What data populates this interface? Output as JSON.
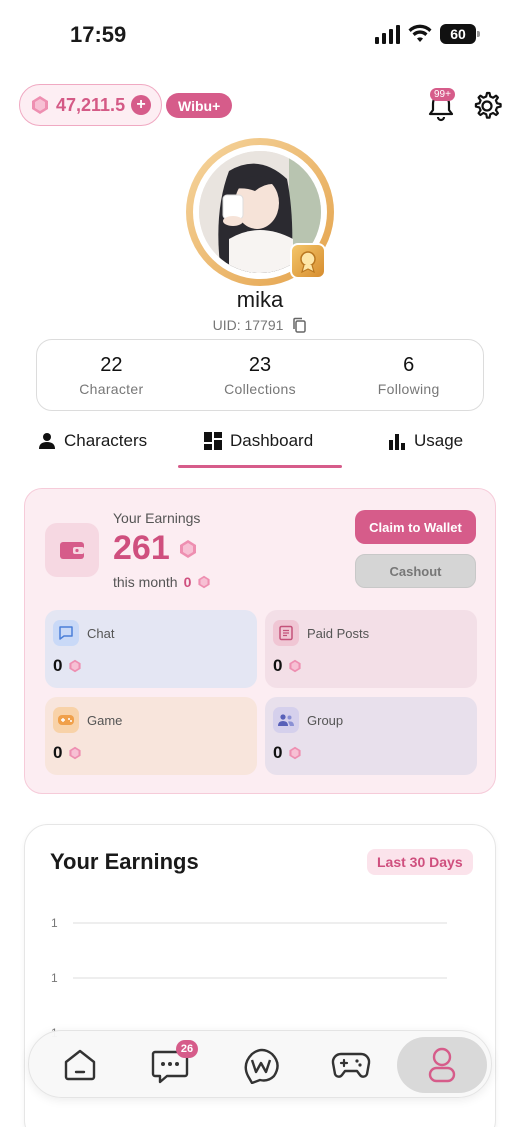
{
  "status_bar": {
    "time": "17:59",
    "battery": "60"
  },
  "header": {
    "gem_balance": "47,211.5",
    "plus_label": "+",
    "membership_badge": "Wibu+",
    "notification_count": "99+"
  },
  "profile": {
    "username": "mika",
    "uid": "UID: 17791"
  },
  "stats": [
    {
      "value": "22",
      "label": "Character"
    },
    {
      "value": "23",
      "label": "Collections"
    },
    {
      "value": "6",
      "label": "Following"
    }
  ],
  "tabs": [
    {
      "label": "Characters",
      "icon": "person-icon"
    },
    {
      "label": "Dashboard",
      "icon": "dashboard-icon",
      "active": true
    },
    {
      "label": "Usage",
      "icon": "bar-chart-icon"
    }
  ],
  "earnings": {
    "title": "Your Earnings",
    "amount": "261",
    "month_label": "this month",
    "month_value": "0",
    "claim_label": "Claim to Wallet",
    "cashout_label": "Cashout",
    "categories": [
      {
        "label": "Chat",
        "value": "0",
        "icon": "chat-icon",
        "color": "#e4e6f3",
        "icon_bg": "#c9d9f7"
      },
      {
        "label": "Paid Posts",
        "value": "0",
        "icon": "document-icon",
        "color": "#f3dfe7",
        "icon_bg": "#f0c6d4"
      },
      {
        "label": "Game",
        "value": "0",
        "icon": "gamepad-icon",
        "color": "#f8e5dc",
        "icon_bg": "#f8d2a8"
      },
      {
        "label": "Group",
        "value": "0",
        "icon": "group-icon",
        "color": "#e8e0ec",
        "icon_bg": "#d5d0ec"
      }
    ]
  },
  "chart": {
    "title": "Your Earnings",
    "range": "Last 30 Days"
  },
  "chart_data": {
    "type": "line",
    "title": "Your Earnings",
    "y_tick_labels": [
      "1",
      "1",
      "1"
    ],
    "series": [],
    "grid": true
  },
  "bottom_nav": {
    "items": [
      {
        "name": "home"
      },
      {
        "name": "messages",
        "badge": "26"
      },
      {
        "name": "wibu-logo"
      },
      {
        "name": "games"
      },
      {
        "name": "profile",
        "active": true
      }
    ]
  },
  "colors": {
    "accent": "#d65c8a",
    "accent_light": "#fcedf2"
  }
}
